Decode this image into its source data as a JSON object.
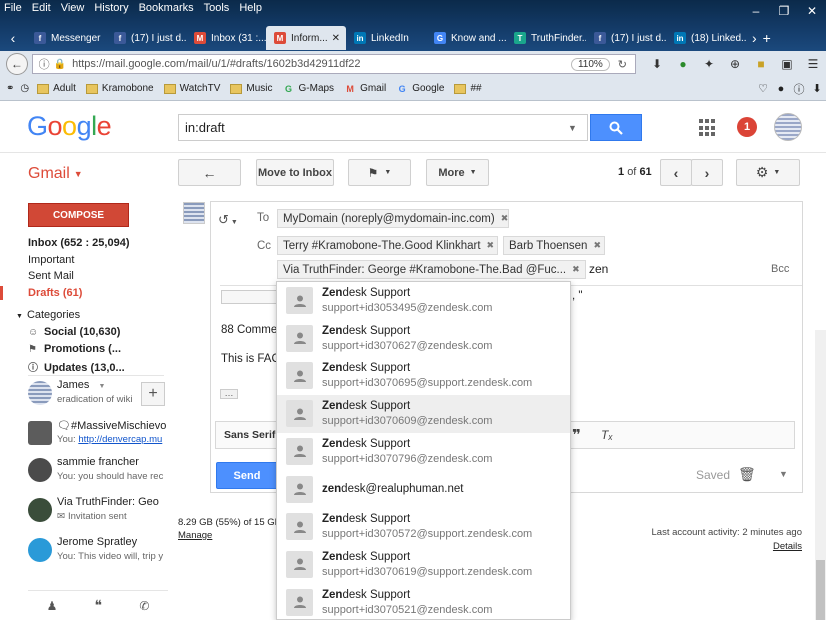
{
  "browser": {
    "menu": [
      "File",
      "Edit",
      "View",
      "History",
      "Bookmarks",
      "Tools",
      "Help"
    ],
    "tabs": [
      {
        "label": "Messenger",
        "color": "#3b5998",
        "glyph": "f"
      },
      {
        "label": "(17) I just d...",
        "color": "#3b5998",
        "glyph": "f"
      },
      {
        "label": "Inbox (31 :...",
        "color": "#dd4b39",
        "glyph": "M"
      },
      {
        "label": "Inform...",
        "color": "#dd4b39",
        "glyph": "M",
        "active": true
      },
      {
        "label": "LinkedIn",
        "color": "#0077b5",
        "glyph": "in"
      },
      {
        "label": "Know and ...",
        "color": "#4285f4",
        "glyph": "G"
      },
      {
        "label": "TruthFinder...",
        "color": "#1aa68c",
        "glyph": "T"
      },
      {
        "label": "(17) I just d...",
        "color": "#3b5998",
        "glyph": "f"
      },
      {
        "label": "(18) Linked...",
        "color": "#0077b5",
        "glyph": "in"
      }
    ],
    "url": "https://mail.google.com/mail/u/1/#drafts/1602b3d42911df22",
    "zoom": "110%",
    "bookmarks": [
      {
        "label": "Adult",
        "type": "folder"
      },
      {
        "label": "Kramobone",
        "type": "folder"
      },
      {
        "label": "WatchTV",
        "type": "folder"
      },
      {
        "label": "Music",
        "type": "folder"
      },
      {
        "label": "G-Maps",
        "type": "maps"
      },
      {
        "label": "Gmail",
        "type": "gmail"
      },
      {
        "label": "Google",
        "type": "google"
      },
      {
        "label": "##",
        "type": "folder"
      }
    ]
  },
  "header": {
    "logo": [
      "G",
      "o",
      "o",
      "g",
      "l",
      "e"
    ],
    "search_value": "in:draft",
    "notification_count": "1"
  },
  "toolbar": {
    "gmail_label": "Gmail",
    "move_to_inbox": "Move to Inbox",
    "more": "More",
    "pager_current": "1",
    "pager_of": "of",
    "pager_total": "61"
  },
  "sidebar": {
    "compose": "COMPOSE",
    "items": [
      {
        "label": "Inbox (652 : 25,094)",
        "style": "bold"
      },
      {
        "label": "Important",
        "style": ""
      },
      {
        "label": "Sent Mail",
        "style": ""
      },
      {
        "label": "Drafts (61)",
        "style": "drafts"
      }
    ],
    "categories_label": "Categories",
    "categories": [
      {
        "label": "Social (10,630)",
        "icon": "people-icon"
      },
      {
        "label": "Promotions (...",
        "icon": "tag-icon"
      },
      {
        "label": "Updates (13,0...",
        "icon": "info-icon"
      }
    ],
    "chats": [
      {
        "name": "James",
        "sub": "eradication of wiki",
        "link": ""
      },
      {
        "name": "🗨#MassiveMischievous",
        "sub": "You: ",
        "link": "http://denvercap.mu"
      },
      {
        "name": "sammie francher",
        "sub": "You: you should have rec",
        "link": ""
      },
      {
        "name": "Via TruthFinder: Geo",
        "sub": "Invitation sent",
        "link": ""
      },
      {
        "name": "Jerome Spratley",
        "sub": "You: This video will, trip y",
        "link": ""
      }
    ]
  },
  "compose": {
    "to_label": "To",
    "cc_label": "Cc",
    "bcc_label": "Bcc",
    "to_chips": [
      "MyDomain (noreply@mydomain-inc.com)"
    ],
    "cc_chips": [
      "Terry #Kramobone-The.Good Klinkhart",
      "Barb Thoensen",
      "Via TruthFinder: George #Kramobone-The.Bad @Fuc..."
    ],
    "cc_typed": "zen",
    "body_lines": [
      "88 Comme",
      "This is FAC"
    ],
    "body_tail": ", \"",
    "font_name": "Sans Serif",
    "send": "Send",
    "saved": "Saved"
  },
  "footer": {
    "storage": "8.29 GB (55%) of 15 GB",
    "manage": "Manage",
    "activity": "Last account activity: 2 minutes ago",
    "details": "Details"
  },
  "suggestions": [
    {
      "prefix": "Zen",
      "rest": "desk Support",
      "email": "support+id3053495@zendesk.com"
    },
    {
      "prefix": "Zen",
      "rest": "desk Support",
      "email": "support+id3070627@zendesk.com"
    },
    {
      "prefix": "Zen",
      "rest": "desk Support",
      "email": "support+id3070695@support.zendesk.com"
    },
    {
      "prefix": "Zen",
      "rest": "desk Support",
      "email": "support+id3070609@zendesk.com",
      "highlighted": true
    },
    {
      "prefix": "Zen",
      "rest": "desk Support",
      "email": "support+id3070796@zendesk.com"
    },
    {
      "prefix": "zen",
      "rest": "desk@realuphuman.net",
      "email": ""
    },
    {
      "prefix": "Zen",
      "rest": "desk Support",
      "email": "support+id3070572@support.zendesk.com"
    },
    {
      "prefix": "Zen",
      "rest": "desk Support",
      "email": "support+id3070619@support.zendesk.com"
    },
    {
      "prefix": "Zen",
      "rest": "desk Support",
      "email": "support+id3070521@zendesk.com"
    }
  ]
}
